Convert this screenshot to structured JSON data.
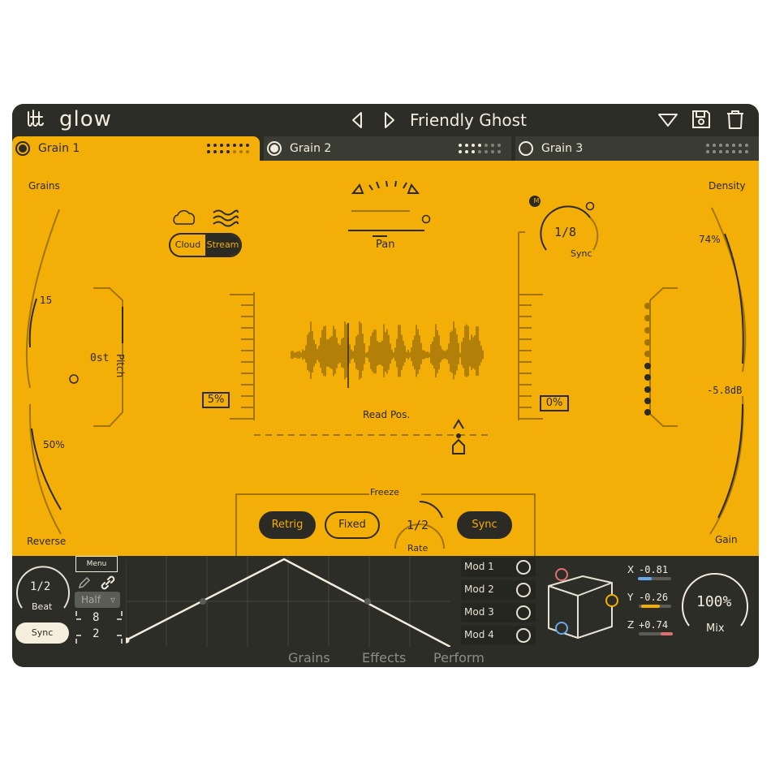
{
  "app": {
    "name": "glow"
  },
  "preset": {
    "name": "Friendly Ghost"
  },
  "tabs": [
    {
      "label": "Grain 1",
      "active": true
    },
    {
      "label": "Grain 2",
      "active": false
    },
    {
      "label": "Grain 3",
      "active": false
    }
  ],
  "main": {
    "grains_label": "Grains",
    "grains_value": "15",
    "reverse_value": "50%",
    "reverse_label": "Reverse",
    "pitch_value": "0st",
    "pitch_label": "Pitch",
    "cloud_label": "Cloud",
    "stream_label": "Stream",
    "pan_label": "Pan",
    "rate_value": "1/8",
    "sync_label": "Sync",
    "m_badge": "M",
    "density_label": "Density",
    "density_value": "74%",
    "gain_value": "-5.8dB",
    "gain_label": "Gain",
    "left_box_value": "5%",
    "right_box_value": "0%",
    "read_pos_label": "Read Pos."
  },
  "freeze": {
    "label": "Freeze",
    "retrig_label": "Retrig",
    "fixed_label": "Fixed",
    "rate_value": "1/2",
    "rate_label": "Rate",
    "sync_label": "Sync"
  },
  "lfo": {
    "beat_value": "1/2",
    "beat_label": "Beat",
    "sync_label": "Sync",
    "menu_label": "Menu",
    "half_label": "Half",
    "steps_top": "8",
    "steps_bottom": "2"
  },
  "mods": [
    {
      "label": "Mod 1"
    },
    {
      "label": "Mod 2"
    },
    {
      "label": "Mod 3"
    },
    {
      "label": "Mod 4"
    }
  ],
  "xyz": {
    "x": {
      "label": "X",
      "value": "-0.81",
      "fraction": 0.19,
      "color": "#6aa9e8"
    },
    "y": {
      "label": "Y",
      "value": "-0.26",
      "fraction": 0.37,
      "color": "#f4ae08"
    },
    "z": {
      "label": "Z",
      "value": "+0.74",
      "fraction": 0.87,
      "color": "#e07070"
    }
  },
  "mix": {
    "value": "100%",
    "label": "Mix"
  },
  "bottom_tabs": [
    "Grains",
    "Effects",
    "Perform"
  ],
  "colors": {
    "accent": "#f4ae08",
    "dark": "#2b2d26",
    "cream": "#f6eedc"
  }
}
